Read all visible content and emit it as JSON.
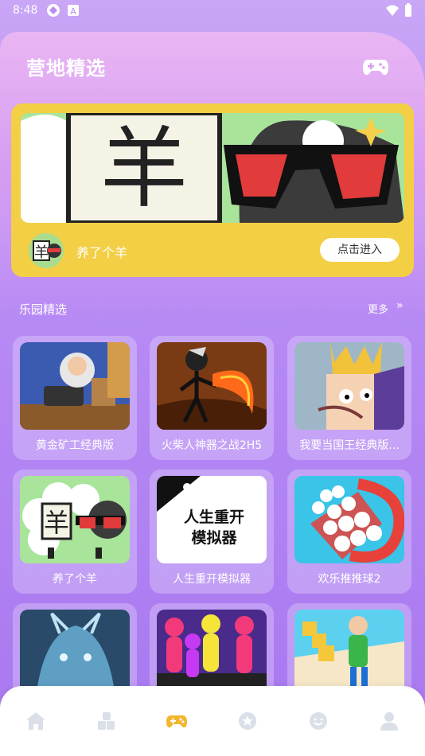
{
  "status_bar": {
    "time": "8:48"
  },
  "header": {
    "title": "营地精选"
  },
  "featured": {
    "game_name": "养了个羊",
    "enter_label": "点击进入"
  },
  "section": {
    "title": "乐园精选",
    "more_label": "更多"
  },
  "games": [
    {
      "name": "黄金矿工经典版"
    },
    {
      "name": "火柴人神器之战2H5"
    },
    {
      "name": "我要当国王经典版..."
    },
    {
      "name": "养了个羊"
    },
    {
      "name": "人生重开模拟器"
    },
    {
      "name": "欢乐推推球2"
    },
    {
      "name": ""
    },
    {
      "name": ""
    },
    {
      "name": ""
    }
  ],
  "thumb_text": {
    "life_restart": "人生重开\n模拟器",
    "sheep_char": "羊"
  },
  "bottom_nav": {
    "items": [
      {
        "icon": "home-icon"
      },
      {
        "icon": "blocks-icon"
      },
      {
        "icon": "gamepad-icon"
      },
      {
        "icon": "star-icon"
      },
      {
        "icon": "smile-icon"
      },
      {
        "icon": "profile-icon"
      }
    ]
  },
  "colors": {
    "accent": "#f3cf45",
    "nav_active": "#f2b630",
    "nav_inactive": "#dadfe8"
  }
}
